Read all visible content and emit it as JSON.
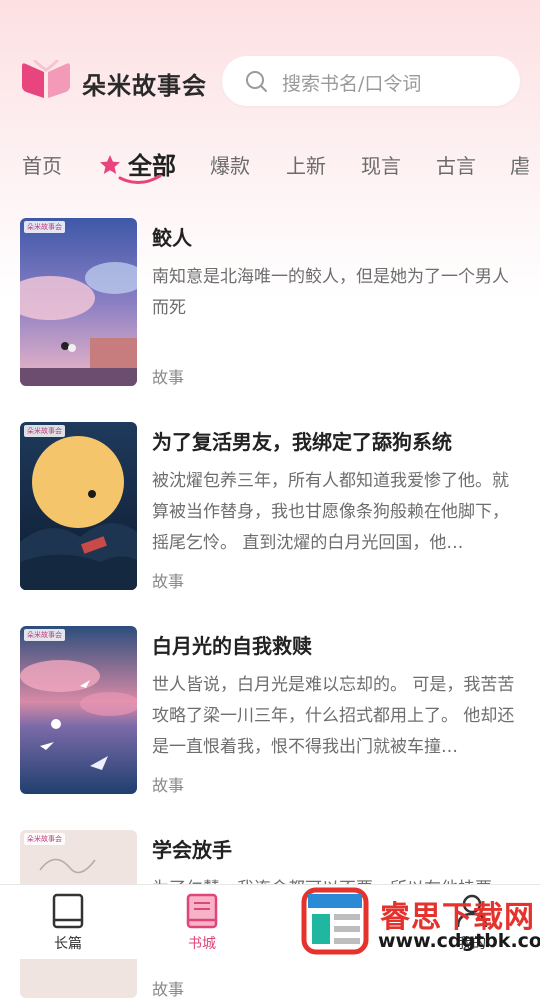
{
  "header": {
    "app_title": "朵米故事会",
    "search_placeholder": "搜索书名/口令词"
  },
  "tabs": [
    {
      "label": "首页"
    },
    {
      "label": "全部",
      "active": true
    },
    {
      "label": "爆款"
    },
    {
      "label": "上新"
    },
    {
      "label": "现言"
    },
    {
      "label": "古言"
    },
    {
      "label": "虐"
    }
  ],
  "books": [
    {
      "title": "鲛人",
      "desc": "南知意是北海唯一的鲛人，但是她为了一个男人而死",
      "tag": "故事",
      "cover_tag": "朵米故事会"
    },
    {
      "title": "为了复活男友，我绑定了舔狗系统",
      "desc": "被沈燿包养三年，所有人都知道我爱惨了他。就算被当作替身，我也甘愿像条狗般赖在他脚下，摇尾乞怜。 直到沈燿的白月光回国，他…",
      "tag": "故事",
      "cover_tag": "朵米故事会"
    },
    {
      "title": "白月光的自我救赎",
      "desc": "世人皆说，白月光是难以忘却的。 可是，我苦苦攻略了梁一川三年，什么招式都用上了。 他却还是一直恨着我，恨不得我出门就被车撞…",
      "tag": "故事",
      "cover_tag": "朵米故事会"
    },
    {
      "title": "学会放手",
      "desc": "为了仁慧，我连命都可以不要，所以在他挂要",
      "tag": "故事",
      "cover_tag": "朵米故事会"
    }
  ],
  "bottom_nav": [
    {
      "label": "长篇",
      "icon": "book-icon"
    },
    {
      "label": "书城",
      "icon": "bookstore-icon",
      "active": true
    },
    {
      "label": "我的",
      "icon": "user-icon"
    }
  ],
  "watermark": {
    "title": "睿思下载网",
    "url": "www.cdgtbk.com"
  },
  "colors": {
    "accent": "#e0457a",
    "header_bg": "#fde0e2"
  }
}
